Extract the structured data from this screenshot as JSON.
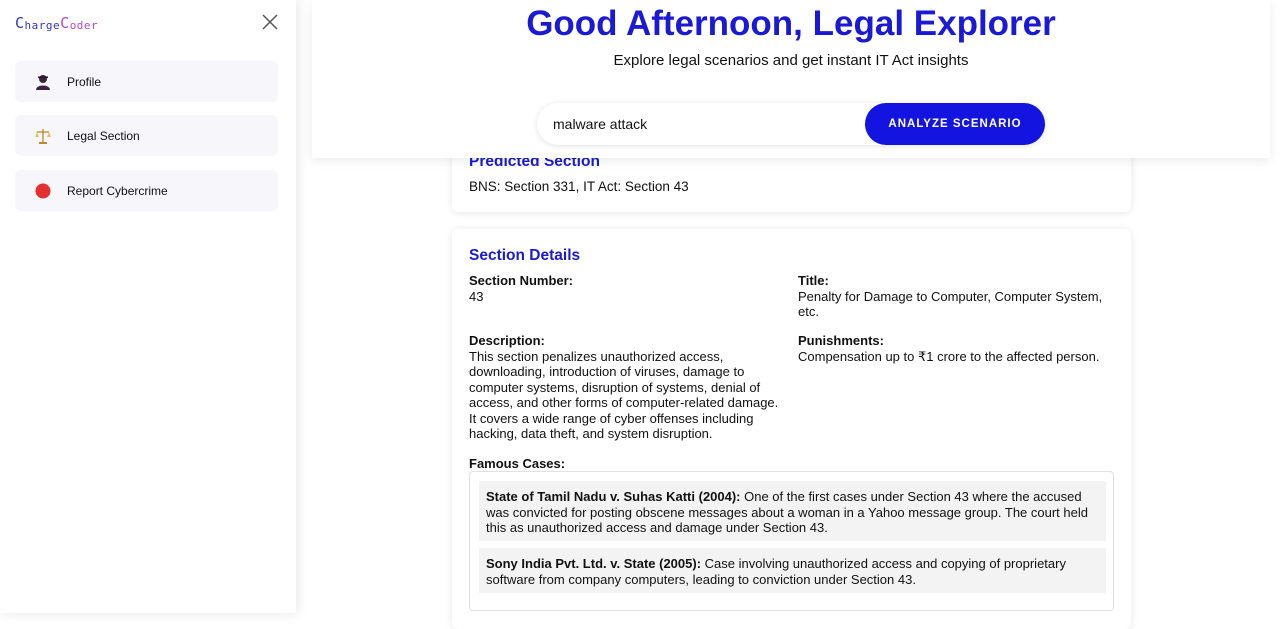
{
  "sidebar": {
    "logo": {
      "part1_big": "C",
      "part1_rest": "harge",
      "part2_big": "C",
      "part2_rest": "oder"
    },
    "items": [
      {
        "label": "Profile",
        "icon": "user-icon"
      },
      {
        "label": "Legal Section",
        "icon": "scales-icon"
      },
      {
        "label": "Report Cybercrime",
        "icon": "red-dot-icon"
      }
    ]
  },
  "header": {
    "greeting": "Good Afternoon, Legal Explorer",
    "subtitle": "Explore legal scenarios and get instant IT Act insights",
    "search_value": "malware attack",
    "analyze_label": "ANALYZE SCENARIO"
  },
  "predicted": {
    "title": "Predicted Section",
    "value": "BNS: Section 331, IT Act: Section 43"
  },
  "details": {
    "title": "Section Details",
    "section_number_label": "Section Number:",
    "section_number": "43",
    "title_label": "Title:",
    "title_value": "Penalty for Damage to Computer, Computer System, etc.",
    "description_label": "Description:",
    "description": "This section penalizes unauthorized access, downloading, introduction of viruses, damage to computer systems, disruption of systems, denial of access, and other forms of computer-related damage. It covers a wide range of cyber offenses including hacking, data theft, and system disruption.",
    "punishments_label": "Punishments:",
    "punishments": "Compensation up to ₹1 crore to the affected person.",
    "famous_cases_label": "Famous Cases:",
    "cases": [
      {
        "title": "State of Tamil Nadu v. Suhas Katti (2004):",
        "text": " One of the first cases under Section 43 where the accused was convicted for posting obscene messages about a woman in a Yahoo message group. The court held this as unauthorized access and damage under Section 43."
      },
      {
        "title": "Sony India Pvt. Ltd. v. State (2005):",
        "text": " Case involving unauthorized access and copying of proprietary software from company computers, leading to conviction under Section 43."
      }
    ]
  },
  "colors": {
    "accent": "#1a1ad6",
    "button": "#1414e0",
    "report_dot": "#e53030"
  }
}
